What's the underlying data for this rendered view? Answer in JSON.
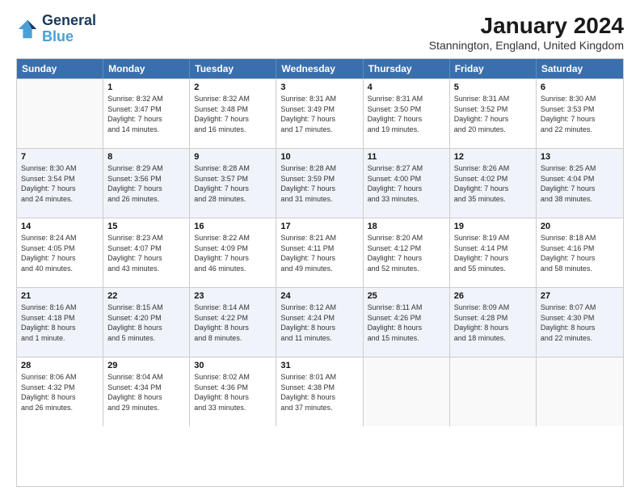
{
  "header": {
    "logo_line1": "General",
    "logo_line2": "Blue",
    "title": "January 2024",
    "subtitle": "Stannington, England, United Kingdom"
  },
  "days_of_week": [
    "Sunday",
    "Monday",
    "Tuesday",
    "Wednesday",
    "Thursday",
    "Friday",
    "Saturday"
  ],
  "weeks": [
    [
      {
        "day": "",
        "info": ""
      },
      {
        "day": "1",
        "info": "Sunrise: 8:32 AM\nSunset: 3:47 PM\nDaylight: 7 hours\nand 14 minutes."
      },
      {
        "day": "2",
        "info": "Sunrise: 8:32 AM\nSunset: 3:48 PM\nDaylight: 7 hours\nand 16 minutes."
      },
      {
        "day": "3",
        "info": "Sunrise: 8:31 AM\nSunset: 3:49 PM\nDaylight: 7 hours\nand 17 minutes."
      },
      {
        "day": "4",
        "info": "Sunrise: 8:31 AM\nSunset: 3:50 PM\nDaylight: 7 hours\nand 19 minutes."
      },
      {
        "day": "5",
        "info": "Sunrise: 8:31 AM\nSunset: 3:52 PM\nDaylight: 7 hours\nand 20 minutes."
      },
      {
        "day": "6",
        "info": "Sunrise: 8:30 AM\nSunset: 3:53 PM\nDaylight: 7 hours\nand 22 minutes."
      }
    ],
    [
      {
        "day": "7",
        "info": "Sunrise: 8:30 AM\nSunset: 3:54 PM\nDaylight: 7 hours\nand 24 minutes."
      },
      {
        "day": "8",
        "info": "Sunrise: 8:29 AM\nSunset: 3:56 PM\nDaylight: 7 hours\nand 26 minutes."
      },
      {
        "day": "9",
        "info": "Sunrise: 8:28 AM\nSunset: 3:57 PM\nDaylight: 7 hours\nand 28 minutes."
      },
      {
        "day": "10",
        "info": "Sunrise: 8:28 AM\nSunset: 3:59 PM\nDaylight: 7 hours\nand 31 minutes."
      },
      {
        "day": "11",
        "info": "Sunrise: 8:27 AM\nSunset: 4:00 PM\nDaylight: 7 hours\nand 33 minutes."
      },
      {
        "day": "12",
        "info": "Sunrise: 8:26 AM\nSunset: 4:02 PM\nDaylight: 7 hours\nand 35 minutes."
      },
      {
        "day": "13",
        "info": "Sunrise: 8:25 AM\nSunset: 4:04 PM\nDaylight: 7 hours\nand 38 minutes."
      }
    ],
    [
      {
        "day": "14",
        "info": "Sunrise: 8:24 AM\nSunset: 4:05 PM\nDaylight: 7 hours\nand 40 minutes."
      },
      {
        "day": "15",
        "info": "Sunrise: 8:23 AM\nSunset: 4:07 PM\nDaylight: 7 hours\nand 43 minutes."
      },
      {
        "day": "16",
        "info": "Sunrise: 8:22 AM\nSunset: 4:09 PM\nDaylight: 7 hours\nand 46 minutes."
      },
      {
        "day": "17",
        "info": "Sunrise: 8:21 AM\nSunset: 4:11 PM\nDaylight: 7 hours\nand 49 minutes."
      },
      {
        "day": "18",
        "info": "Sunrise: 8:20 AM\nSunset: 4:12 PM\nDaylight: 7 hours\nand 52 minutes."
      },
      {
        "day": "19",
        "info": "Sunrise: 8:19 AM\nSunset: 4:14 PM\nDaylight: 7 hours\nand 55 minutes."
      },
      {
        "day": "20",
        "info": "Sunrise: 8:18 AM\nSunset: 4:16 PM\nDaylight: 7 hours\nand 58 minutes."
      }
    ],
    [
      {
        "day": "21",
        "info": "Sunrise: 8:16 AM\nSunset: 4:18 PM\nDaylight: 8 hours\nand 1 minute."
      },
      {
        "day": "22",
        "info": "Sunrise: 8:15 AM\nSunset: 4:20 PM\nDaylight: 8 hours\nand 5 minutes."
      },
      {
        "day": "23",
        "info": "Sunrise: 8:14 AM\nSunset: 4:22 PM\nDaylight: 8 hours\nand 8 minutes."
      },
      {
        "day": "24",
        "info": "Sunrise: 8:12 AM\nSunset: 4:24 PM\nDaylight: 8 hours\nand 11 minutes."
      },
      {
        "day": "25",
        "info": "Sunrise: 8:11 AM\nSunset: 4:26 PM\nDaylight: 8 hours\nand 15 minutes."
      },
      {
        "day": "26",
        "info": "Sunrise: 8:09 AM\nSunset: 4:28 PM\nDaylight: 8 hours\nand 18 minutes."
      },
      {
        "day": "27",
        "info": "Sunrise: 8:07 AM\nSunset: 4:30 PM\nDaylight: 8 hours\nand 22 minutes."
      }
    ],
    [
      {
        "day": "28",
        "info": "Sunrise: 8:06 AM\nSunset: 4:32 PM\nDaylight: 8 hours\nand 26 minutes."
      },
      {
        "day": "29",
        "info": "Sunrise: 8:04 AM\nSunset: 4:34 PM\nDaylight: 8 hours\nand 29 minutes."
      },
      {
        "day": "30",
        "info": "Sunrise: 8:02 AM\nSunset: 4:36 PM\nDaylight: 8 hours\nand 33 minutes."
      },
      {
        "day": "31",
        "info": "Sunrise: 8:01 AM\nSunset: 4:38 PM\nDaylight: 8 hours\nand 37 minutes."
      },
      {
        "day": "",
        "info": ""
      },
      {
        "day": "",
        "info": ""
      },
      {
        "day": "",
        "info": ""
      }
    ]
  ]
}
